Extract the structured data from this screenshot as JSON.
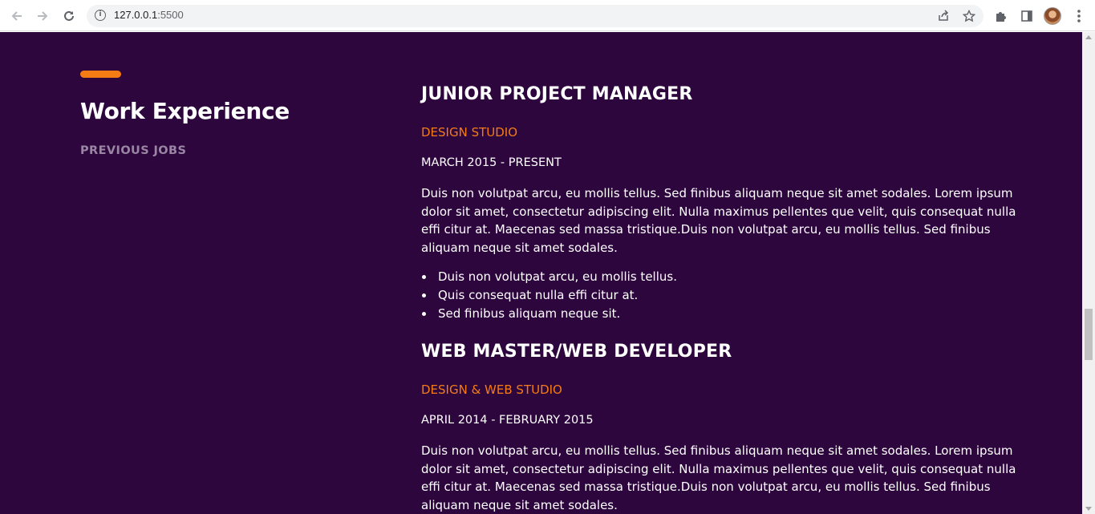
{
  "browser": {
    "url_host": "127.0.0.1",
    "url_port": ":5500",
    "info_icon": "i"
  },
  "section": {
    "title": "Work Experience",
    "subtitle": "PREVIOUS JOBS",
    "accent_color": "#f57c14",
    "background_color": "#2d063d"
  },
  "jobs": [
    {
      "title": "JUNIOR PROJECT MANAGER",
      "company": "DESIGN STUDIO",
      "dates": "MARCH 2015 - PRESENT",
      "description": "Duis non volutpat arcu, eu mollis tellus. Sed finibus aliquam neque sit amet sodales. Lorem ipsum dolor sit amet, consectetur adipiscing elit. Nulla maximus pellentes que velit, quis consequat nulla effi citur at. Maecenas sed massa tristique.Duis non volutpat arcu, eu mollis tellus. Sed finibus aliquam neque sit amet sodales.",
      "bullets": [
        "Duis non volutpat arcu, eu mollis tellus.",
        "Quis consequat nulla effi citur at.",
        "Sed finibus aliquam neque sit."
      ]
    },
    {
      "title": "WEB MASTER/WEB DEVELOPER",
      "company": "DESIGN & WEB STUDIO",
      "dates": "APRIL 2014 - FEBRUARY 2015",
      "description": "Duis non volutpat arcu, eu mollis tellus. Sed finibus aliquam neque sit amet sodales. Lorem ipsum dolor sit amet, consectetur adipiscing elit. Nulla maximus pellentes que velit, quis consequat nulla effi citur at. Maecenas sed massa tristique.Duis non volutpat arcu, eu mollis tellus. Sed finibus aliquam neque sit amet sodales."
    }
  ]
}
